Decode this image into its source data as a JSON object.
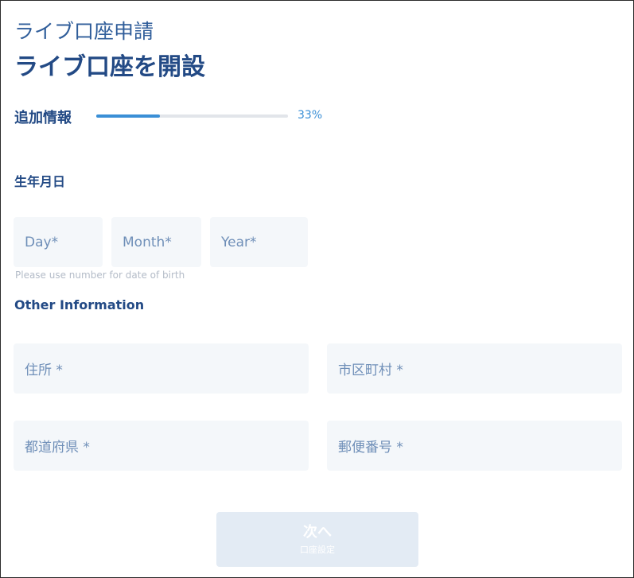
{
  "header": {
    "subtitle": "ライブ口座申請",
    "title": "ライブ口座を開設"
  },
  "progress": {
    "step_label": "追加情報",
    "percent_text": "33%",
    "value": 0.33,
    "track_color": "#e2e5ea",
    "fill_color": "#3a8fd6"
  },
  "birth": {
    "label": "生年月日",
    "day_placeholder": "Day*",
    "month_placeholder": "Month*",
    "year_placeholder": "Year*",
    "hint": "Please use number for date of birth"
  },
  "other": {
    "label": "Other Information",
    "address_placeholder": "住所 *",
    "city_placeholder": "市区町村 *",
    "prefecture_placeholder": "都道府県 *",
    "postal_placeholder": "郵便番号 *"
  },
  "next_button": {
    "label": "次へ",
    "sublabel": "口座設定"
  },
  "colors": {
    "primary_text": "#234a85",
    "accent": "#3a8fd6",
    "field_bg": "#f4f7fa",
    "button_bg": "#e3ebf4"
  }
}
